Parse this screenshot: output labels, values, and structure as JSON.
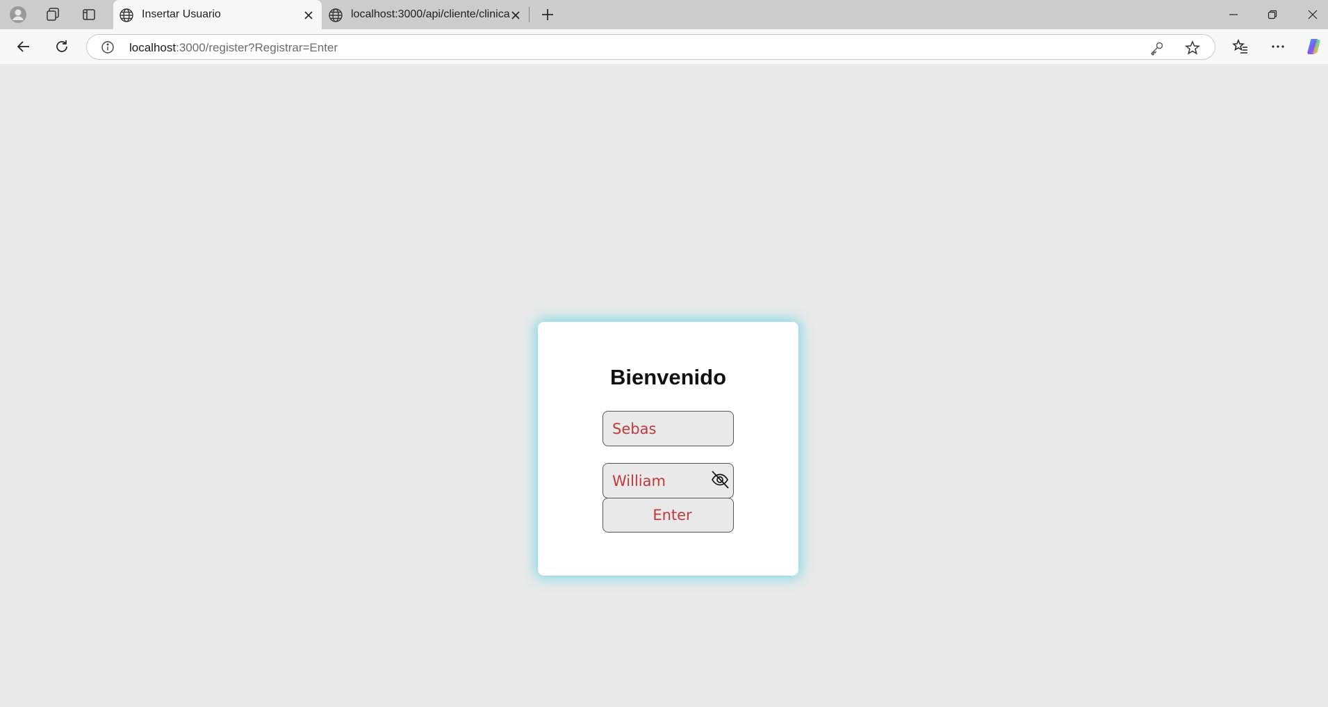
{
  "browser": {
    "tabs": [
      {
        "title": "Insertar Usuario",
        "active": true
      },
      {
        "title": "localhost:3000/api/cliente/clinica",
        "active": false
      }
    ],
    "url_host": "localhost",
    "url_rest": ":3000/register?Registrar=Enter"
  },
  "icons": {
    "profile": "profile-icon",
    "workspaces": "workspaces-icon",
    "tab_actions": "vertical-tabs-icon",
    "tab_favicon": "globe-icon",
    "back": "back-arrow-icon",
    "refresh": "refresh-icon",
    "site_info": "info-icon",
    "password": "key-icon",
    "favorite": "star-icon",
    "favorites_list": "favorites-icon",
    "menu": "more-icon",
    "copilot": "copilot-icon",
    "toggle_password": "eye-slash-icon"
  },
  "login": {
    "heading": "Bienvenido",
    "username_value": "Sebas",
    "password_value": "William",
    "submit_label": "Enter"
  },
  "colors": {
    "accent_text": "#c1393c",
    "card_glow": "#6ed7e8",
    "page_bg": "#e9e9e9"
  }
}
